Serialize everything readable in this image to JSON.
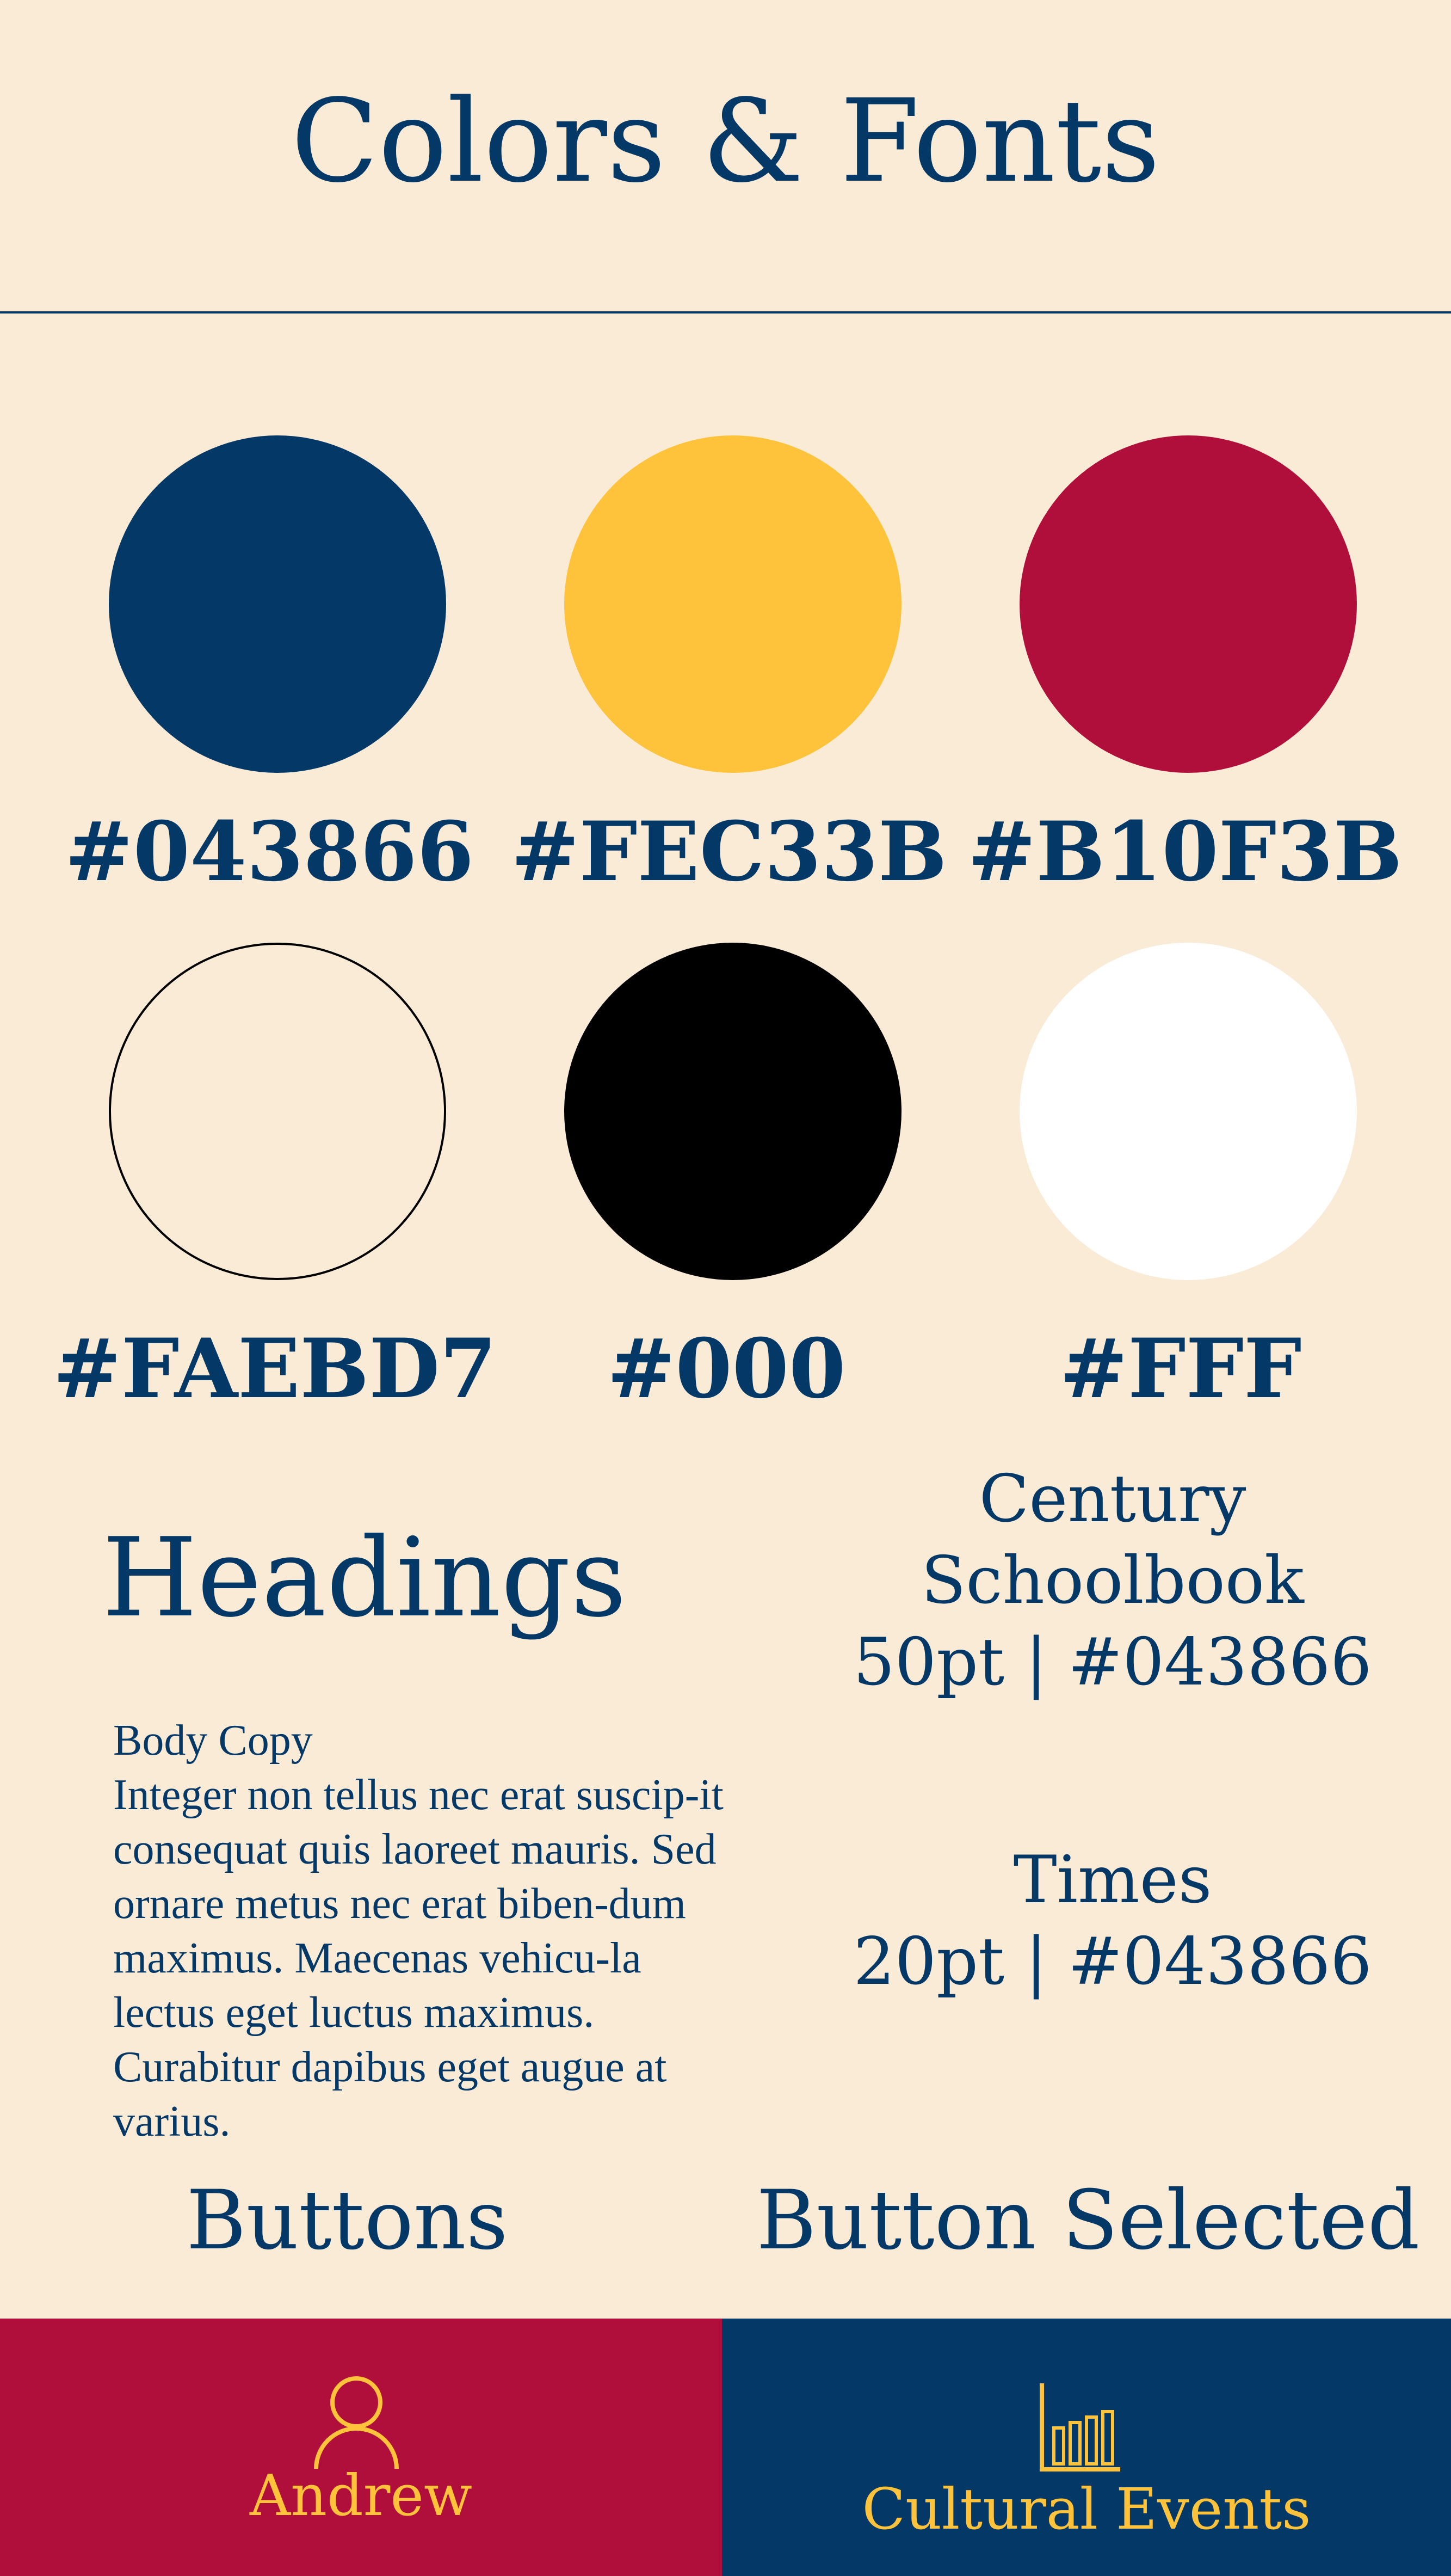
{
  "header": {
    "title": "Colors & Fonts"
  },
  "palette": [
    {
      "hex": "#043866",
      "color": "#043866"
    },
    {
      "hex": "#FEC33B",
      "color": "#FEC33B"
    },
    {
      "hex": "#B10F3B",
      "color": "#B10F3B"
    },
    {
      "hex": "#FAEBD7",
      "color": "#FAEBD7"
    },
    {
      "hex": "#000",
      "color": "#000000"
    },
    {
      "hex": "#FFF",
      "color": "#FFFFFF"
    }
  ],
  "typography": {
    "headings_sample": "Headings",
    "headings_font": {
      "line1": "Century",
      "line2": "Schoolbook",
      "line3": "50pt | #043866"
    },
    "body_title": "Body Copy",
    "body_text": "Integer non tellus nec erat suscip-it consequat quis laoreet mauris. Sed ornare metus nec erat biben-dum maximus. Maecenas vehicu-la lectus eget luctus maximus. Curabitur dapibus eget augue at varius.",
    "body_font": {
      "line1": "Times",
      "line2": "20pt | #043866"
    }
  },
  "buttons": {
    "label": "Buttons",
    "selected_label": "Button Selected",
    "default_button": {
      "text": "Andrew",
      "icon": "user-icon",
      "bg": "#B10F3B",
      "fg": "#FEC33B"
    },
    "selected_button": {
      "text": "Cultural Events",
      "icon": "bar-chart-icon",
      "bg": "#043866",
      "fg": "#FEC33B"
    }
  }
}
